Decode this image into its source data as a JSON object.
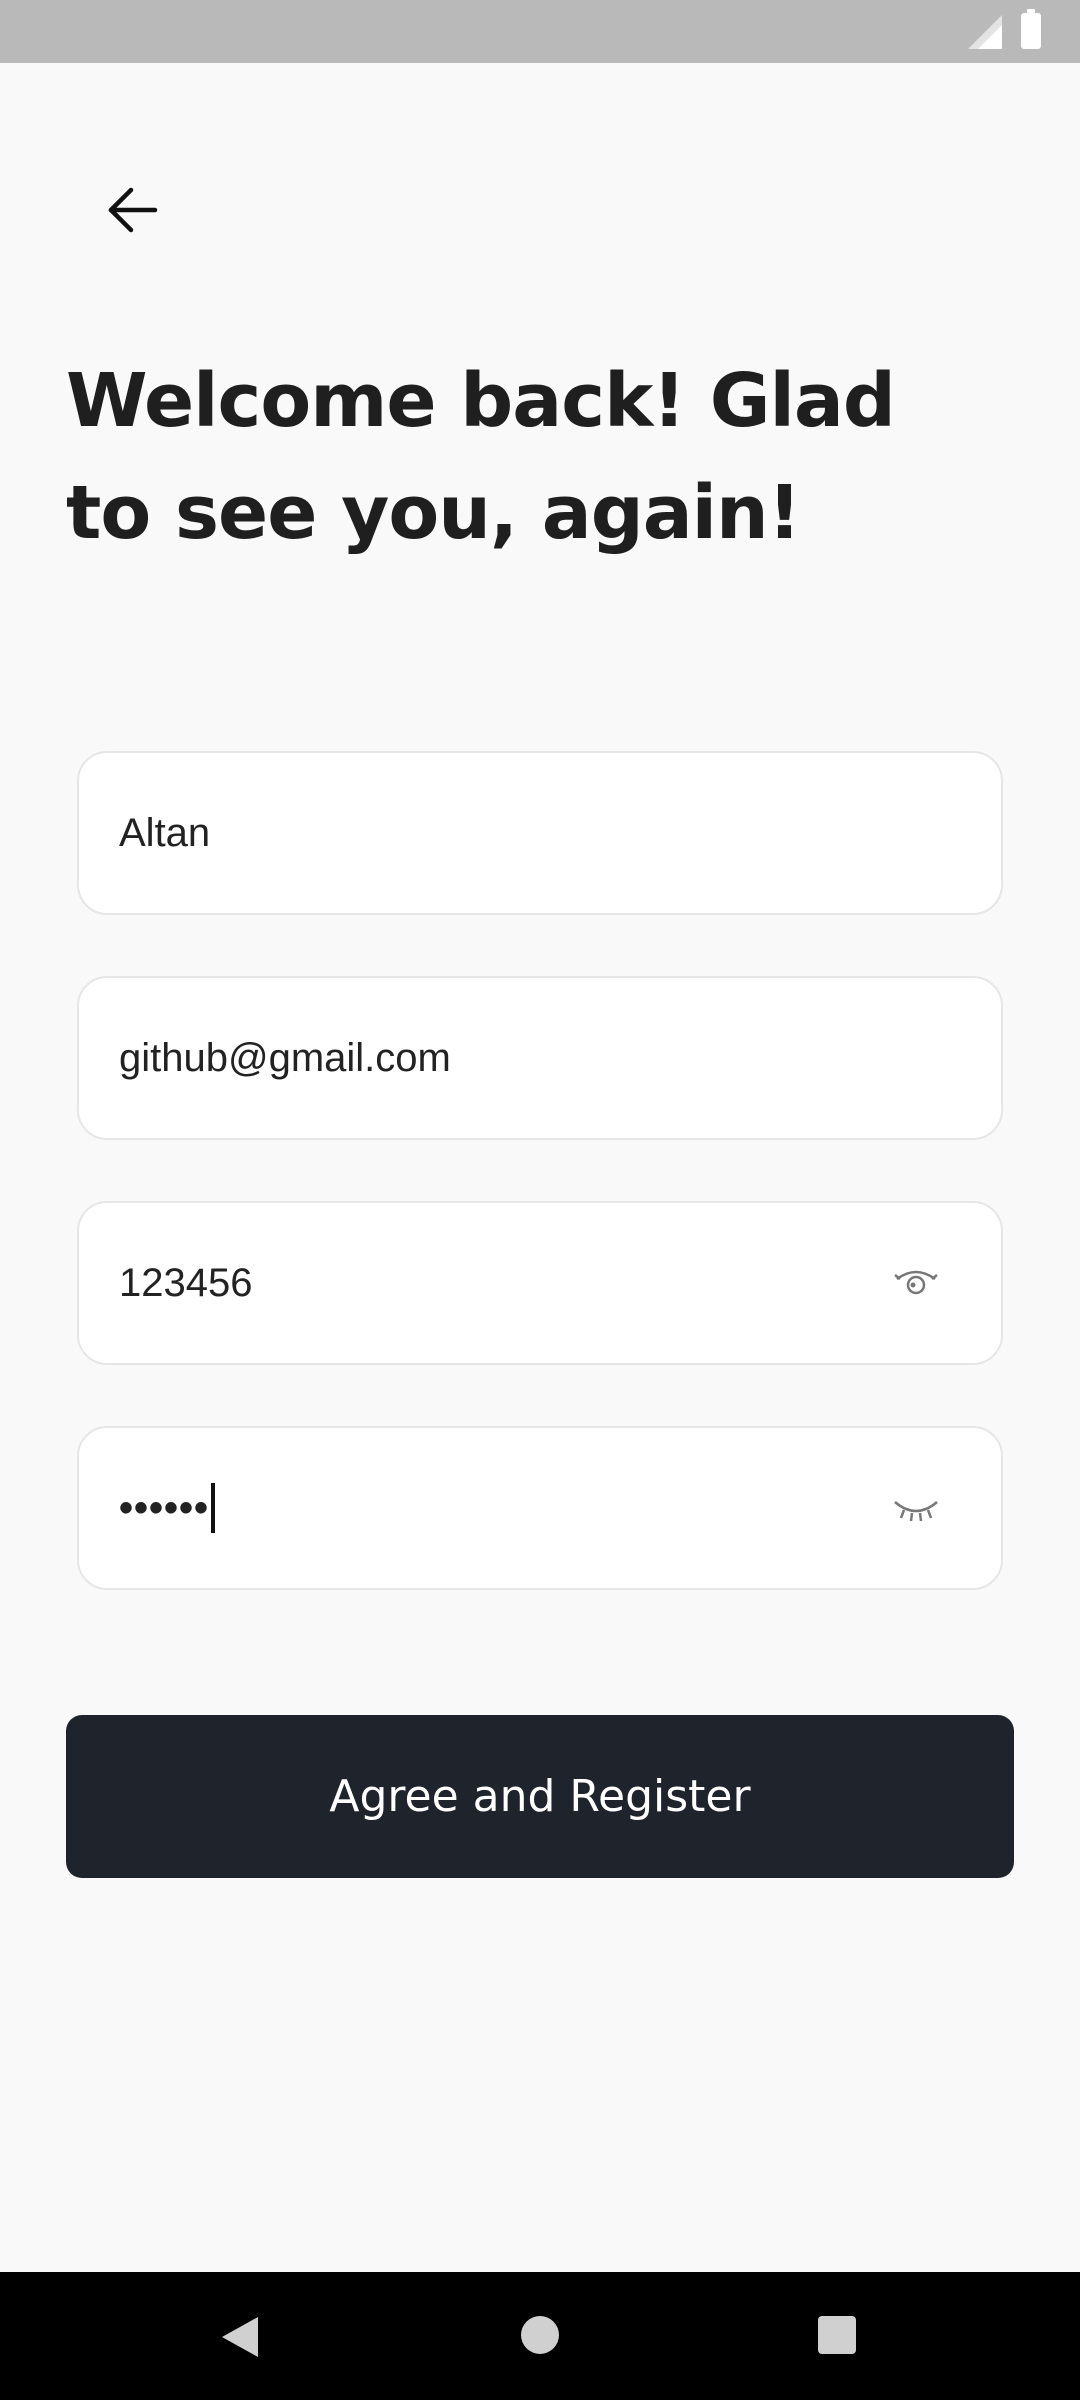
{
  "screen": {
    "title_line1": "Welcome back! Glad",
    "title_line2": "to see you, again!"
  },
  "form": {
    "username": "Altan",
    "email": "github@gmail.com",
    "password": "123456",
    "confirm_password_masked": "••••••"
  },
  "actions": {
    "register_label": "Agree and Register"
  },
  "icons": {
    "back": "arrow-left-icon",
    "show_password": "eye-open-icon",
    "hide_password": "eye-closed-icon"
  },
  "colors": {
    "background": "#f9f9f9",
    "button": "#1e232c",
    "title": "#1f1f1f",
    "status_bar": "#b9b9b9"
  }
}
